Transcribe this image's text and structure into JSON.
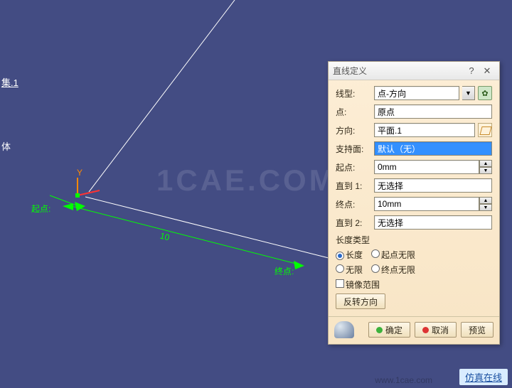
{
  "watermarks": {
    "center": "1CAE.COM",
    "bottom_right": "www.1cae.com"
  },
  "tree": {
    "item1": "集.1",
    "item2": "体"
  },
  "axis_labels": {
    "start": "起点:",
    "y": "Y",
    "dim": "10",
    "end": "终点:"
  },
  "dialog": {
    "title": "直线定义",
    "rows": {
      "line_type": {
        "label": "线型:",
        "value": "点-方向"
      },
      "point": {
        "label": "点:",
        "value": "原点"
      },
      "direction": {
        "label": "方向:",
        "value": "平面.1"
      },
      "support": {
        "label": "支持面:",
        "value": "默认（无）"
      },
      "start": {
        "label": "起点:",
        "value": "0mm"
      },
      "upto1": {
        "label": "直到 1:",
        "value": "无选择"
      },
      "end": {
        "label": "终点:",
        "value": "10mm"
      },
      "upto2": {
        "label": "直到 2:",
        "value": "无选择"
      }
    },
    "length_type_label": "长度类型",
    "radios": {
      "length": "长度",
      "start_inf": "起点无限",
      "inf": "无限",
      "end_inf": "终点无限"
    },
    "mirror_checkbox": "镜像范围",
    "reverse_btn": "反转方向",
    "buttons": {
      "ok": "确定",
      "cancel": "取消",
      "preview": "预览"
    }
  },
  "bottom_link": "仿真在线"
}
